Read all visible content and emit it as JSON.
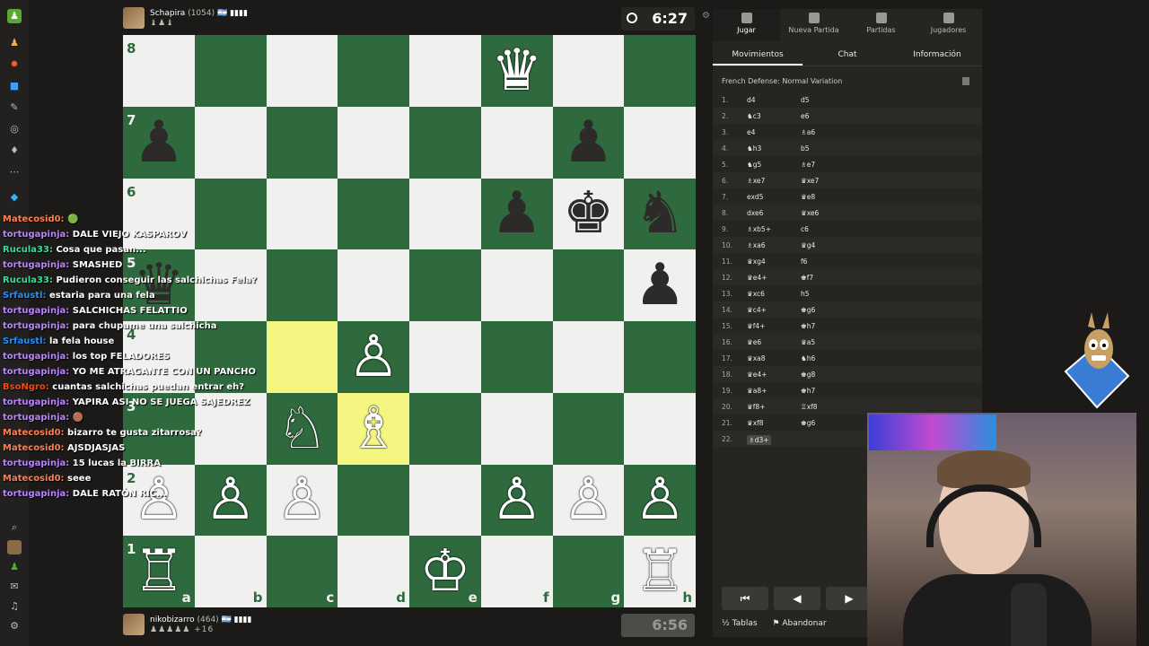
{
  "top_player": {
    "name": "Schapira",
    "rating": "(1054)",
    "flag": "🇦🇷",
    "bars": "▮▮▮▮",
    "captured": "♝♟♝",
    "clock": "6:27"
  },
  "bottom_player": {
    "name": "nikobizarro",
    "rating": "(464)",
    "flag": "🇦🇷",
    "bars": "▮▮▮▮",
    "captured": "♟♟♟♟♟",
    "captured_extra": "+16",
    "clock": "6:56"
  },
  "board": {
    "ranks": [
      "8",
      "7",
      "6",
      "5",
      "4",
      "3",
      "2",
      "1"
    ],
    "files": [
      "a",
      "b",
      "c",
      "d",
      "e",
      "f",
      "g",
      "h"
    ],
    "highlight": [
      "c4",
      "d3"
    ],
    "pieces": {
      "f8": "♛",
      "a7": "♟",
      "g7": "♟",
      "f6": "♟",
      "g6": "♚",
      "h6": "♞",
      "a5": "♛",
      "h5": "♟",
      "d4": "♙",
      "c3": "♘",
      "d3": "♗",
      "a2": "♙",
      "b2": "♙",
      "c2": "♙",
      "f2": "♙",
      "g2": "♙",
      "h2": "♙",
      "a1": "♖",
      "e1": "♔",
      "h1": "♖"
    },
    "white_squares": [
      "f8",
      "d4",
      "c3",
      "d3",
      "a2",
      "b2",
      "c2",
      "f2",
      "g2",
      "h2",
      "a1",
      "e1",
      "h1"
    ]
  },
  "chat": [
    {
      "user": "Matecosid0:",
      "msg": "🟢",
      "color": "#ff7f50"
    },
    {
      "user": "tortugapinja:",
      "msg": "DALE VIEJO KASPAROV",
      "color": "#b983ff"
    },
    {
      "user": "Rucula33:",
      "msg": "Cosa que pasan...",
      "color": "#3ddc97"
    },
    {
      "user": "tortugapinja:",
      "msg": "SMASHED",
      "color": "#b983ff"
    },
    {
      "user": "Rucula33:",
      "msg": "Pudieron conseguir las salchichas Fela?",
      "color": "#3ddc97"
    },
    {
      "user": "Srfaustl:",
      "msg": "estaria para una fela",
      "color": "#1e90ff"
    },
    {
      "user": "tortugapinja:",
      "msg": "SALCHICHAS FELATTIO",
      "color": "#b983ff"
    },
    {
      "user": "tortugapinja:",
      "msg": "para chupame una salchicha",
      "color": "#b983ff"
    },
    {
      "user": "Srfaustl:",
      "msg": "la fela house",
      "color": "#1e90ff"
    },
    {
      "user": "tortugapinja:",
      "msg": "los top FELADORES",
      "color": "#b983ff"
    },
    {
      "user": "tortugapinja:",
      "msg": "YO ME ATRAGANTE CON UN PANCHO",
      "color": "#b983ff"
    },
    {
      "user": "BsoNgro:",
      "msg": "cuantas salchichas puedan entrar eh?",
      "color": "#ff4500"
    },
    {
      "user": "tortugapinja:",
      "msg": "YAPIRA ASI NO SE JUEGA SAJEDREZ",
      "color": "#b983ff"
    },
    {
      "user": "tortugapinja:",
      "msg": "🟤",
      "color": "#b983ff"
    },
    {
      "user": "Matecosid0:",
      "msg": "bizarro te gusta zitarrosa?",
      "color": "#ff7f50"
    },
    {
      "user": "Matecosid0:",
      "msg": "AJSDJASJAS",
      "color": "#ff7f50"
    },
    {
      "user": "tortugapinja:",
      "msg": "15 lucas la BIRRA",
      "color": "#b983ff"
    },
    {
      "user": "Matecosid0:",
      "msg": "seee",
      "color": "#ff7f50"
    },
    {
      "user": "tortugapinja:",
      "msg": "DALE RATÓN RIC...",
      "color": "#b983ff"
    }
  ],
  "panel": {
    "topnav": [
      "Jugar",
      "Nueva Partida",
      "Partidas",
      "Jugadores"
    ],
    "tabs": [
      "Movimientos",
      "Chat",
      "Información"
    ],
    "opening": "French Defense: Normal Variation",
    "moves": [
      [
        "1.",
        "d4",
        "d5"
      ],
      [
        "2.",
        "♞c3",
        "e6"
      ],
      [
        "3.",
        "e4",
        "♗a6"
      ],
      [
        "4.",
        "♞h3",
        "b5"
      ],
      [
        "5.",
        "♞g5",
        "♗e7"
      ],
      [
        "6.",
        "♗xe7",
        "♛xe7"
      ],
      [
        "7.",
        "exd5",
        "♛e8"
      ],
      [
        "8.",
        "dxe6",
        "♛xe6"
      ],
      [
        "9.",
        "♗xb5+",
        "c6"
      ],
      [
        "10.",
        "♗xa6",
        "♛g4"
      ],
      [
        "11.",
        "♛xg4",
        "f6"
      ],
      [
        "12.",
        "♛e4+",
        "♚f7"
      ],
      [
        "13.",
        "♛xc6",
        "h5"
      ],
      [
        "14.",
        "♛c4+",
        "♚g6"
      ],
      [
        "15.",
        "♛f4+",
        "♚h7"
      ],
      [
        "16.",
        "♛e6",
        "♛a5"
      ],
      [
        "17.",
        "♛xa8",
        "♞h6"
      ],
      [
        "18.",
        "♛e4+",
        "♚g8"
      ],
      [
        "19.",
        "♛a8+",
        "♚h7"
      ],
      [
        "20.",
        "♛f8+",
        "♖xf8"
      ],
      [
        "21.",
        "♛xf8",
        "♚g6"
      ],
      [
        "22.",
        "♗d3+",
        ""
      ]
    ],
    "nav": [
      "⏮",
      "◀",
      "▶"
    ],
    "actions": [
      "½ Tablas",
      "⚑ Abandonar"
    ]
  }
}
